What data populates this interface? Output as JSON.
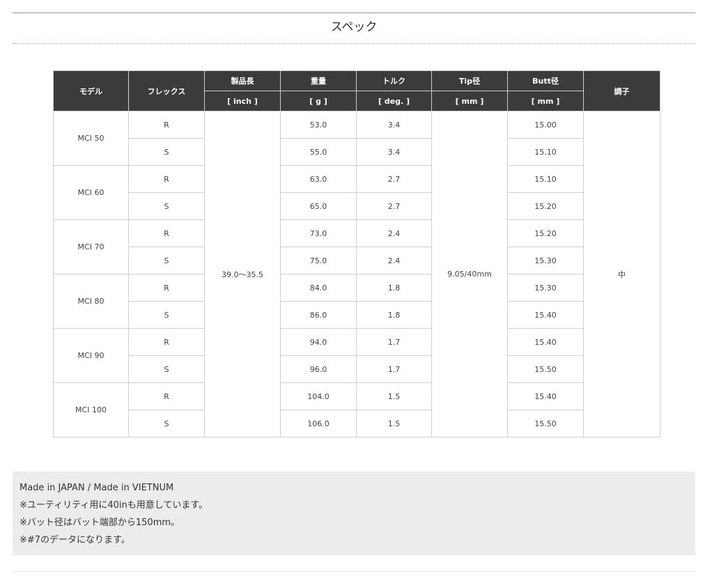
{
  "section": {
    "title": "スペック"
  },
  "table": {
    "headers": {
      "model": "モデル",
      "flex": "フレックス",
      "length": "製品長",
      "weight": "重量",
      "torque": "トルク",
      "tip": "Tip径",
      "butt": "Butt径",
      "kick": "調子"
    },
    "units": {
      "length": "[ inch ]",
      "weight": "[ g ]",
      "torque": "[ deg. ]",
      "tip": "[ mm ]",
      "butt": "[ mm ]"
    },
    "length_all": "39.0～35.5",
    "tip_all": "9.05/40mm",
    "kick_all": "中",
    "rows": [
      {
        "model": "MCI 50",
        "flex": "R",
        "weight": "53.0",
        "torque": "3.4",
        "butt": "15.00"
      },
      {
        "model": "MCI 50",
        "flex": "S",
        "weight": "55.0",
        "torque": "3.4",
        "butt": "15.10"
      },
      {
        "model": "MCI 60",
        "flex": "R",
        "weight": "63.0",
        "torque": "2.7",
        "butt": "15.10"
      },
      {
        "model": "MCI 60",
        "flex": "S",
        "weight": "65.0",
        "torque": "2.7",
        "butt": "15.20"
      },
      {
        "model": "MCI 70",
        "flex": "R",
        "weight": "73.0",
        "torque": "2.4",
        "butt": "15.20"
      },
      {
        "model": "MCI 70",
        "flex": "S",
        "weight": "75.0",
        "torque": "2.4",
        "butt": "15.30"
      },
      {
        "model": "MCI 80",
        "flex": "R",
        "weight": "84.0",
        "torque": "1.8",
        "butt": "15.30"
      },
      {
        "model": "MCI 80",
        "flex": "S",
        "weight": "86.0",
        "torque": "1.8",
        "butt": "15.40"
      },
      {
        "model": "MCI 90",
        "flex": "R",
        "weight": "94.0",
        "torque": "1.7",
        "butt": "15.40"
      },
      {
        "model": "MCI 90",
        "flex": "S",
        "weight": "96.0",
        "torque": "1.7",
        "butt": "15.50"
      },
      {
        "model": "MCI 100",
        "flex": "R",
        "weight": "104.0",
        "torque": "1.5",
        "butt": "15.40"
      },
      {
        "model": "MCI 100",
        "flex": "S",
        "weight": "106.0",
        "torque": "1.5",
        "butt": "15.50"
      }
    ]
  },
  "notes": [
    "Made in JAPAN / Made in VIETNUM",
    "※ユーティリティ用に40inも用意しています。",
    "※バット径はバット端部から150mm。",
    "※#7のデータになります。"
  ]
}
